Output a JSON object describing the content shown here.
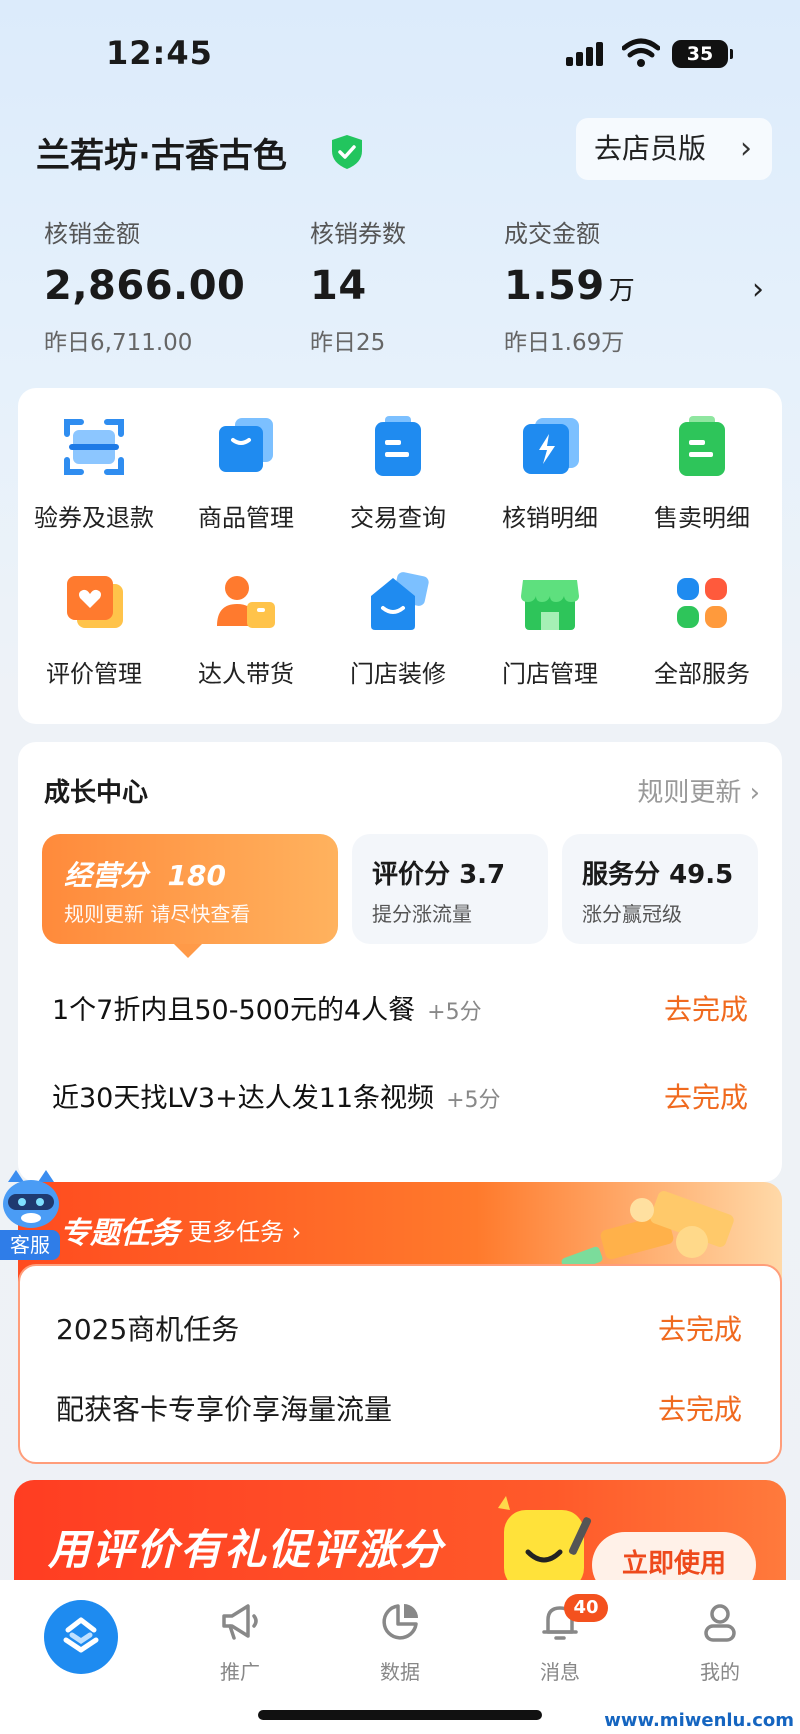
{
  "status_bar": {
    "time": "12:45",
    "battery": "35"
  },
  "shop": {
    "name": "兰若坊·古香古色",
    "staff_button": "去店员版"
  },
  "stats": [
    {
      "label": "核销金额",
      "value": "2,866.00",
      "unit": "",
      "prev": "昨日6,711.00"
    },
    {
      "label": "核销券数",
      "value": "14",
      "unit": "",
      "prev": "昨日25"
    },
    {
      "label": "成交金额",
      "value": "1.59",
      "unit": "万",
      "prev": "昨日1.69万"
    }
  ],
  "services": [
    {
      "label": "验券及退款",
      "icon": "scan-icon"
    },
    {
      "label": "商品管理",
      "icon": "product-box-icon"
    },
    {
      "label": "交易查询",
      "icon": "transaction-icon"
    },
    {
      "label": "核销明细",
      "icon": "lightning-icon"
    },
    {
      "label": "售卖明细",
      "icon": "sales-icon"
    },
    {
      "label": "评价管理",
      "icon": "review-heart-icon"
    },
    {
      "label": "达人带货",
      "icon": "influencer-icon"
    },
    {
      "label": "门店装修",
      "icon": "store-decor-icon"
    },
    {
      "label": "门店管理",
      "icon": "store-icon"
    },
    {
      "label": "全部服务",
      "icon": "all-services-icon"
    }
  ],
  "growth": {
    "title": "成长中心",
    "rules_link": "规则更新",
    "main_score": {
      "label": "经营分",
      "value": "180",
      "sub": "规则更新 请尽快查看"
    },
    "review_score": {
      "label": "评价分",
      "value": "3.7",
      "sub": "提分涨流量"
    },
    "service_score": {
      "label": "服务分",
      "value": "49.5",
      "sub": "涨分赢冠级"
    },
    "tasks": [
      {
        "text": "1个7折内且50-500元的4人餐",
        "points": "+5分",
        "action": "去完成"
      },
      {
        "text": "近30天找LV3+达人发11条视频",
        "points": "+5分",
        "action": "去完成"
      }
    ]
  },
  "special_tasks": {
    "title": "专题任务",
    "more": "更多任务",
    "items": [
      {
        "text": "2025商机任务",
        "action": "去完成"
      },
      {
        "text": "配获客卡专享价享海量流量",
        "action": "去完成"
      }
    ]
  },
  "support": {
    "label": "客服"
  },
  "promo": {
    "text": "用评价有礼促评涨分",
    "button": "立即使用"
  },
  "tabbar": {
    "items": [
      {
        "label": "推广",
        "icon": "megaphone-icon"
      },
      {
        "label": "数据",
        "icon": "pie-chart-icon"
      },
      {
        "label": "消息",
        "icon": "bell-icon",
        "badge": "40"
      },
      {
        "label": "我的",
        "icon": "user-icon"
      }
    ]
  },
  "watermark": "www.miwenlu.com",
  "colors": {
    "accent": "#f06a1f",
    "primary_blue": "#1e8bf0",
    "verified_green": "#22c55e"
  }
}
